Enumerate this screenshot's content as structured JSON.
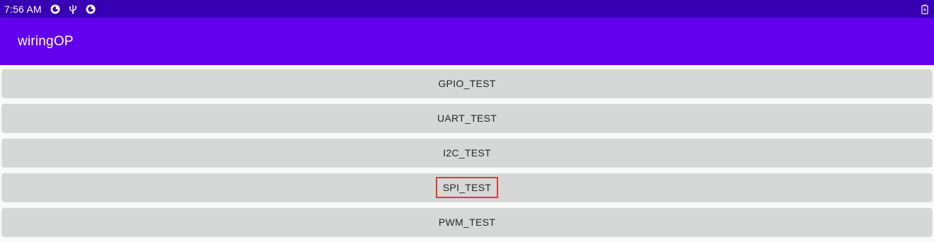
{
  "status_bar": {
    "time": "7:56 AM",
    "icons": [
      "notification-icon",
      "usb-icon",
      "notification-icon"
    ],
    "battery_icon": "battery-charging-icon",
    "background": "#3700b3"
  },
  "app_bar": {
    "title": "wiringOP",
    "background": "#6200ee"
  },
  "buttons": [
    {
      "label": "GPIO_TEST",
      "highlighted": false
    },
    {
      "label": "UART_TEST",
      "highlighted": false
    },
    {
      "label": "I2C_TEST",
      "highlighted": false
    },
    {
      "label": "SPI_TEST",
      "highlighted": true
    },
    {
      "label": "PWM_TEST",
      "highlighted": false
    }
  ],
  "colors": {
    "button_bg": "#d6d7d7",
    "highlight": "#e53935"
  }
}
